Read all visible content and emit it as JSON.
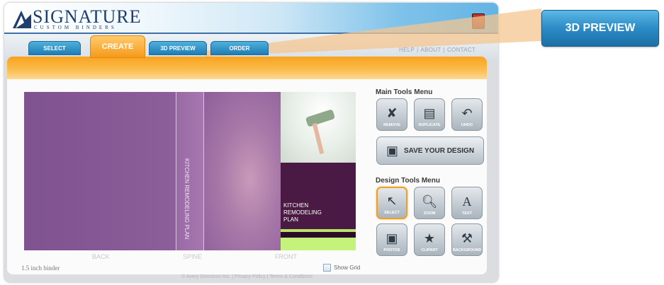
{
  "brand": {
    "name": "SIGNATURE",
    "tagline": "CUSTOM BINDERS"
  },
  "tabs": [
    {
      "label": "SELECT"
    },
    {
      "label": "CREATE"
    },
    {
      "label": "3D PREVIEW"
    },
    {
      "label": "ORDER"
    }
  ],
  "active_tab": "CREATE",
  "top_links": [
    "HELP",
    "ABOUT",
    "CONTACT"
  ],
  "design": {
    "spine_text": "KITCHEN REMODELING PLAN",
    "front_title_lines": [
      "KITCHEN",
      "REMODELING",
      "PLAN"
    ],
    "section_labels": [
      "BACK",
      "SPINE",
      "FRONT"
    ],
    "binder_size": "1.5 inch binder",
    "show_grid_label": "Show Grid"
  },
  "main_tools": {
    "title": "Main Tools Menu",
    "buttons": [
      {
        "label": "REMOVE",
        "icon": "remove-icon"
      },
      {
        "label": "DUPLICATE",
        "icon": "duplicate-icon"
      },
      {
        "label": "UNDO",
        "icon": "undo-icon"
      }
    ],
    "save_label": "SAVE YOUR DESIGN"
  },
  "design_tools": {
    "title": "Design Tools Menu",
    "buttons": [
      {
        "label": "SELECT",
        "icon": "pointer-icon",
        "selected": true
      },
      {
        "label": "ZOOM",
        "icon": "zoom-icon"
      },
      {
        "label": "TEXT",
        "icon": "text-icon"
      },
      {
        "label": "PHOTOS",
        "icon": "photos-icon"
      },
      {
        "label": "CLIPART",
        "icon": "clipart-icon"
      },
      {
        "label": "BACKGROUND",
        "icon": "background-icon"
      }
    ]
  },
  "footer": "© Avery Dennison Inc. | Privacy Policy | Terms & Conditions",
  "callout": {
    "label": "3D PREVIEW"
  },
  "colors": {
    "tab_blue": "#2c8bc6",
    "tab_orange": "#f59a1b",
    "design_purple": "#8a5a96",
    "front_dark": "#4a1a44",
    "front_green": "#c4f27a"
  }
}
